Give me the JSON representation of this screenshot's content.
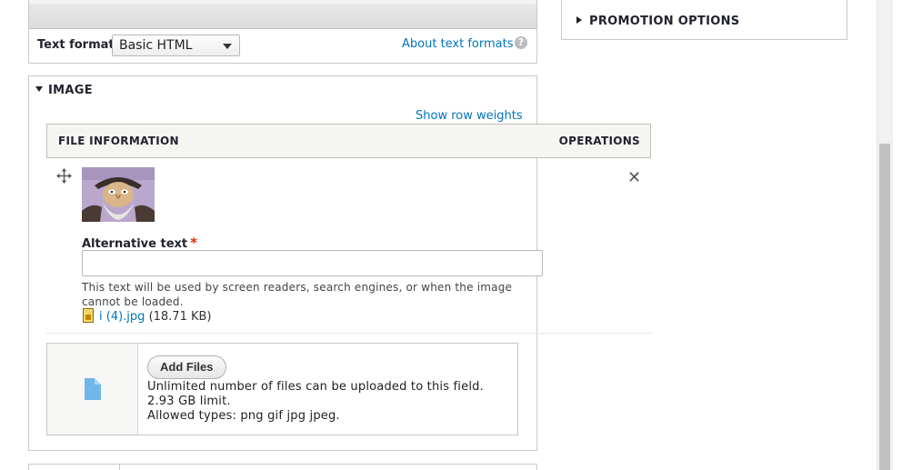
{
  "text_format": {
    "label": "Text format",
    "selected": "Basic HTML",
    "about_link": "About text formats",
    "help_glyph": "?"
  },
  "promotion": {
    "summary": "PROMOTION OPTIONS"
  },
  "image_field": {
    "legend": "IMAGE",
    "row_weights_link": "Show row weights",
    "table": {
      "col_file": "FILE INFORMATION",
      "col_ops": "OPERATIONS"
    },
    "item": {
      "alt_label": "Alternative text",
      "required_mark": "*",
      "alt_value": "",
      "alt_description": "This text will be used by screen readers, search engines, or when the image cannot be loaded.",
      "file_name": "i (4).jpg",
      "file_size": "(18.71 KB)",
      "remove_glyph": "✕"
    },
    "upload": {
      "button": "Add Files",
      "info_line1": "Unlimited number of files can be uploaded to this field.",
      "info_line2": "2.93 GB limit.",
      "info_line3": "Allowed types: png gif jpg jpeg."
    }
  },
  "icons": {
    "drag": "move-cross-icon",
    "remove": "close-icon",
    "file": "image-file-icon",
    "upload": "document-icon",
    "help": "help-icon"
  },
  "colors": {
    "link": "#0074bd",
    "required": "#e62600",
    "table_head_bg": "#f5f5f2",
    "upload_icon": "#6fb7e8"
  }
}
